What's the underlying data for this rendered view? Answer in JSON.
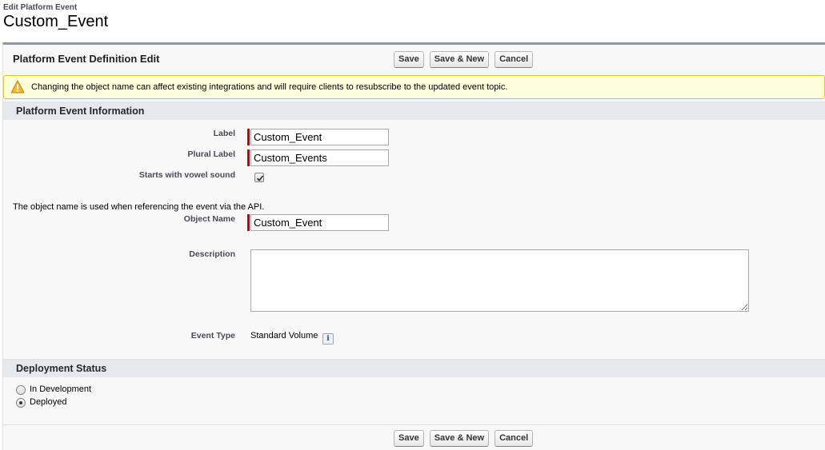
{
  "page": {
    "subtitle": "Edit Platform Event",
    "title": "Custom_Event"
  },
  "panel": {
    "title": "Platform Event Definition Edit",
    "buttons": {
      "save": "Save",
      "save_new": "Save & New",
      "cancel": "Cancel"
    }
  },
  "warning": {
    "icon": "warning-triangle-icon",
    "text": "Changing the object name can affect existing integrations and will require clients to resubscribe to the updated event topic."
  },
  "info_section": {
    "title": "Platform Event Information",
    "label_label": "Label",
    "label_value": "Custom_Event",
    "plural_label": "Plural Label",
    "plural_value": "Custom_Events",
    "vowel_label": "Starts with vowel sound",
    "vowel_checked": true,
    "api_note": "The object name is used when referencing the event via the API.",
    "object_name_label": "Object Name",
    "object_name_value": "Custom_Event",
    "description_label": "Description",
    "description_value": "",
    "event_type_label": "Event Type",
    "event_type_value": "Standard Volume",
    "info_icon_glyph": "i"
  },
  "deployment": {
    "title": "Deployment Status",
    "options": [
      {
        "label": "In Development",
        "selected": false
      },
      {
        "label": "Deployed",
        "selected": true
      }
    ]
  },
  "colors": {
    "required": "#cc0000",
    "warning_bg": "#ffffdc",
    "warning_border": "#e3c23b",
    "section_bg": "#e6e9ec"
  }
}
